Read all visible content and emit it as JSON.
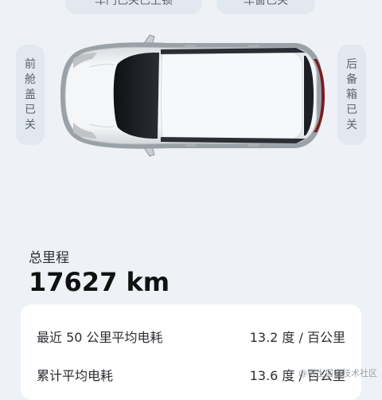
{
  "status": {
    "doors": "车门已关已上锁",
    "window": "车窗已关",
    "front_hood": [
      "前",
      "舱",
      "盖",
      "已",
      "关"
    ],
    "trunk": [
      "后",
      "备",
      "箱",
      "已",
      "关"
    ]
  },
  "odometer": {
    "label": "总里程",
    "value": "17627 km"
  },
  "consumption": {
    "rows": [
      {
        "label": "最近 50 公里平均电耗",
        "value": "13.2 度 / 百公里"
      },
      {
        "label": "累计平均电耗",
        "value": "13.6 度 / 百公里"
      }
    ]
  },
  "watermark": "@稀土掘金技术社区",
  "colors": {
    "background": "#eef2f6",
    "pill": "#e2e8ef",
    "card": "#ffffff",
    "car_body": "#f4f5f6",
    "taillight": "#7a1b1f"
  }
}
